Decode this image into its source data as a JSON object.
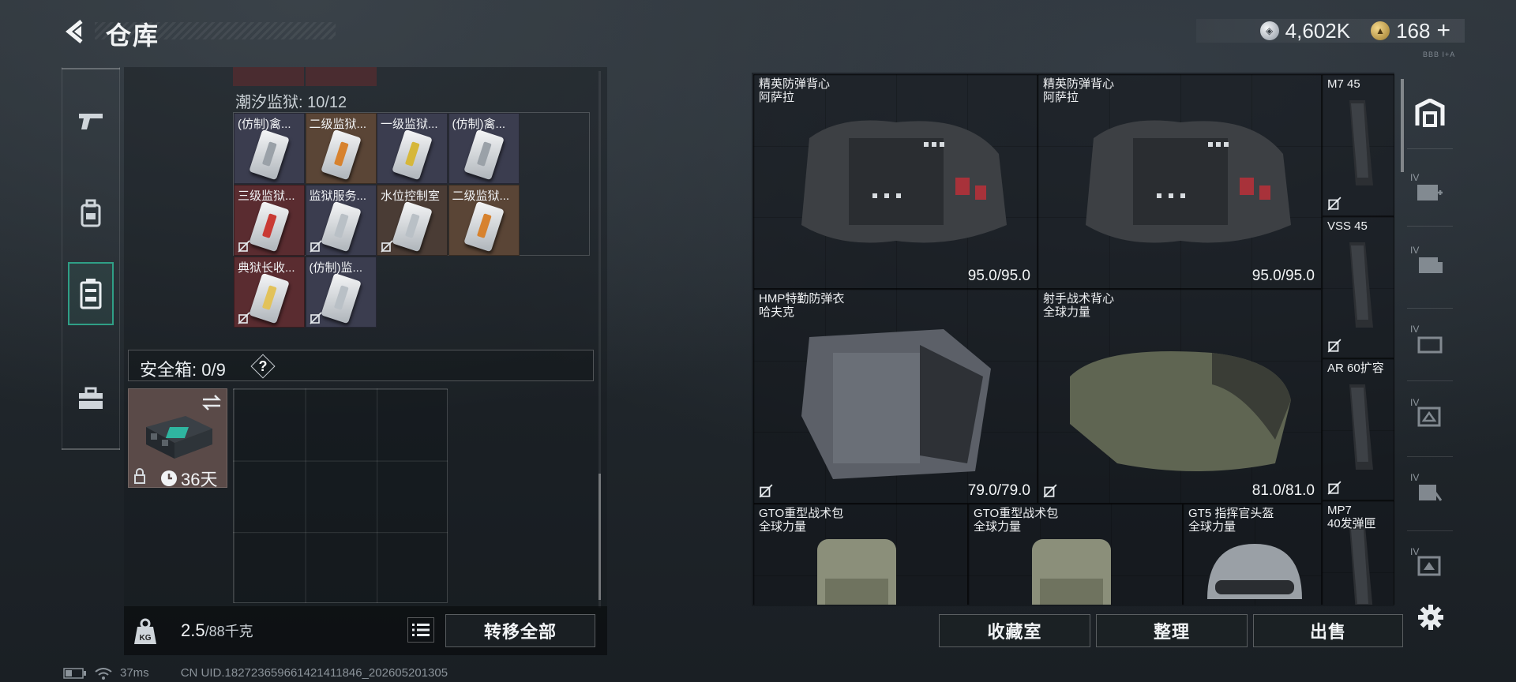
{
  "header": {
    "title": "仓库"
  },
  "currency": {
    "silver": "4,602K",
    "gold": "168",
    "gold_plus": "+",
    "tiny_label": "BBB I+A"
  },
  "left_nav": [
    "weapon",
    "backpack",
    "inventory",
    "toolkit"
  ],
  "inventory": {
    "prison_label": "潮汐监狱: 10/12",
    "cards": [
      {
        "label": "(仿制)禽...",
        "stripe": "#9aa1a8",
        "bg": "#3b3d4f",
        "noswap": false
      },
      {
        "label": "二级监狱...",
        "stripe": "#d7822e",
        "bg": "#5a4536",
        "noswap": false
      },
      {
        "label": "一级监狱...",
        "stripe": "#d6b73a",
        "bg": "#3b3d4f",
        "noswap": false
      },
      {
        "label": "(仿制)禽...",
        "stripe": "#9aa1a8",
        "bg": "#3b3d4f",
        "noswap": false
      },
      {
        "label": "三级监狱...",
        "stripe": "#c93a34",
        "bg": "#5a2c30",
        "noswap": true
      },
      {
        "label": "监狱服务...",
        "stripe": "#b9c0c6",
        "bg": "#3b3d4f",
        "noswap": true
      },
      {
        "label": "水位控制室",
        "stripe": "#b9c0c6",
        "bg": "#4a3c35",
        "noswap": true
      },
      {
        "label": "二级监狱...",
        "stripe": "#d7822e",
        "bg": "#5a4536",
        "noswap": false
      },
      {
        "label": "典狱长收...",
        "stripe": "#e2c25a",
        "bg": "#5a2c30",
        "noswap": true
      },
      {
        "label": "(仿制)监...",
        "stripe": "#b9c0c6",
        "bg": "#3b3d4f",
        "noswap": true
      }
    ],
    "safe_label": "安全箱: 0/9",
    "help": "?",
    "safe_days": "36天",
    "weight_value": "2.5",
    "weight_unit": "/88千克",
    "transfer_all": "转移全部"
  },
  "warehouse": {
    "items": [
      {
        "name": "精英防弹背心\n阿萨拉",
        "dur": "95.0/95.0",
        "style": "bg-brown",
        "noswap": false
      },
      {
        "name": "精英防弹背心\n阿萨拉",
        "dur": "95.0/95.0",
        "style": "bg-brown",
        "noswap": false
      },
      {
        "name": "M7 45",
        "dur": "",
        "style": "bg-gray",
        "noswap": true
      },
      {
        "name": "VSS 45",
        "dur": "",
        "style": "bg-gray",
        "noswap": true
      },
      {
        "name": "AR 60扩容",
        "dur": "",
        "style": "bg-gray",
        "noswap": true
      },
      {
        "name": "HMP特勤防弹衣\n哈夫克",
        "dur": "79.0/79.0",
        "style": "bg-purple",
        "noswap": true
      },
      {
        "name": "射手战术背心\n全球力量",
        "dur": "81.0/81.0",
        "style": "bg-blue",
        "noswap": true
      },
      {
        "name": "GTO重型战术包\n全球力量",
        "dur": "",
        "style": "bg-red",
        "noswap": false
      },
      {
        "name": "GTO重型战术包\n全球力量",
        "dur": "",
        "style": "bg-red",
        "noswap": false
      },
      {
        "name": "GT5 指挥官头盔\n全球力量",
        "dur": "",
        "style": "bg-red",
        "noswap": false
      },
      {
        "name": "MP7\n40发弹匣",
        "dur": "",
        "style": "bg-gray",
        "noswap": false
      }
    ],
    "buttons": {
      "collection": "收藏室",
      "organize": "整理",
      "sell": "出售"
    }
  },
  "right_nav": {
    "tiers": [
      "IV",
      "IV",
      "IV",
      "IV",
      "IV",
      "IV"
    ]
  },
  "status": {
    "ping": "37ms",
    "uid": "CN UID.182723659661421411846_202605201305"
  }
}
